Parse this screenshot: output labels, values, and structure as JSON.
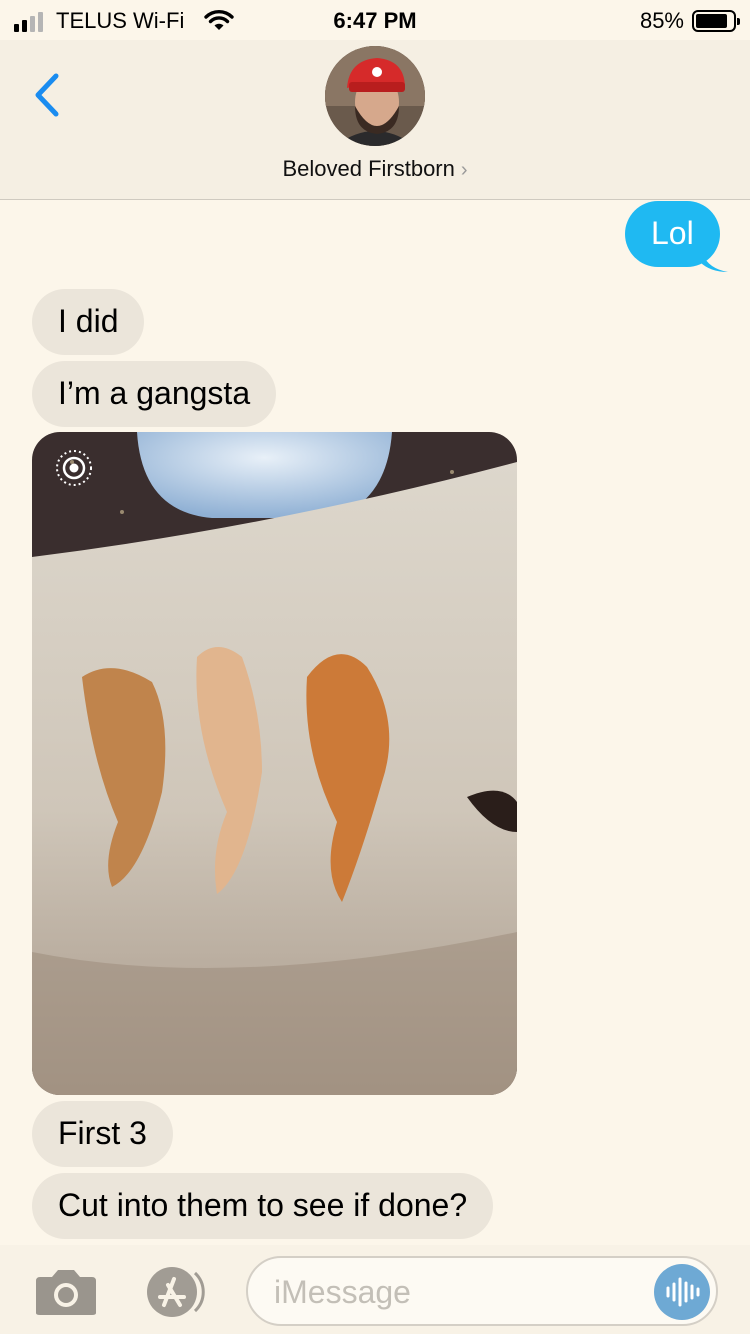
{
  "status_bar": {
    "carrier": "TELUS Wi-Fi",
    "time": "6:47 PM",
    "battery_percent": "85%",
    "battery_level": 0.85,
    "signal_bars": 2
  },
  "header": {
    "back_icon": "chevron-left-icon",
    "contact_name": "Beloved Firstborn",
    "contact_chevron": "›"
  },
  "messages": [
    {
      "direction": "outgoing",
      "text": "Lol"
    },
    {
      "direction": "incoming",
      "text": "I did"
    },
    {
      "direction": "incoming",
      "text": "I’m a gangsta"
    },
    {
      "direction": "incoming",
      "type": "photo",
      "live_photo": true
    },
    {
      "direction": "incoming",
      "text": "First 3"
    },
    {
      "direction": "incoming",
      "text": "Cut into them to see if done?"
    }
  ],
  "input_bar": {
    "placeholder": "iMessage",
    "camera_icon": "camera-icon",
    "apps_icon": "app-store-icon",
    "audio_icon": "audio-waveform-icon"
  },
  "colors": {
    "outgoing_bubble": "#1fb9f2",
    "incoming_bubble": "#ebe5da",
    "accent": "#1a8cf0",
    "background": "#fcf6ea"
  }
}
